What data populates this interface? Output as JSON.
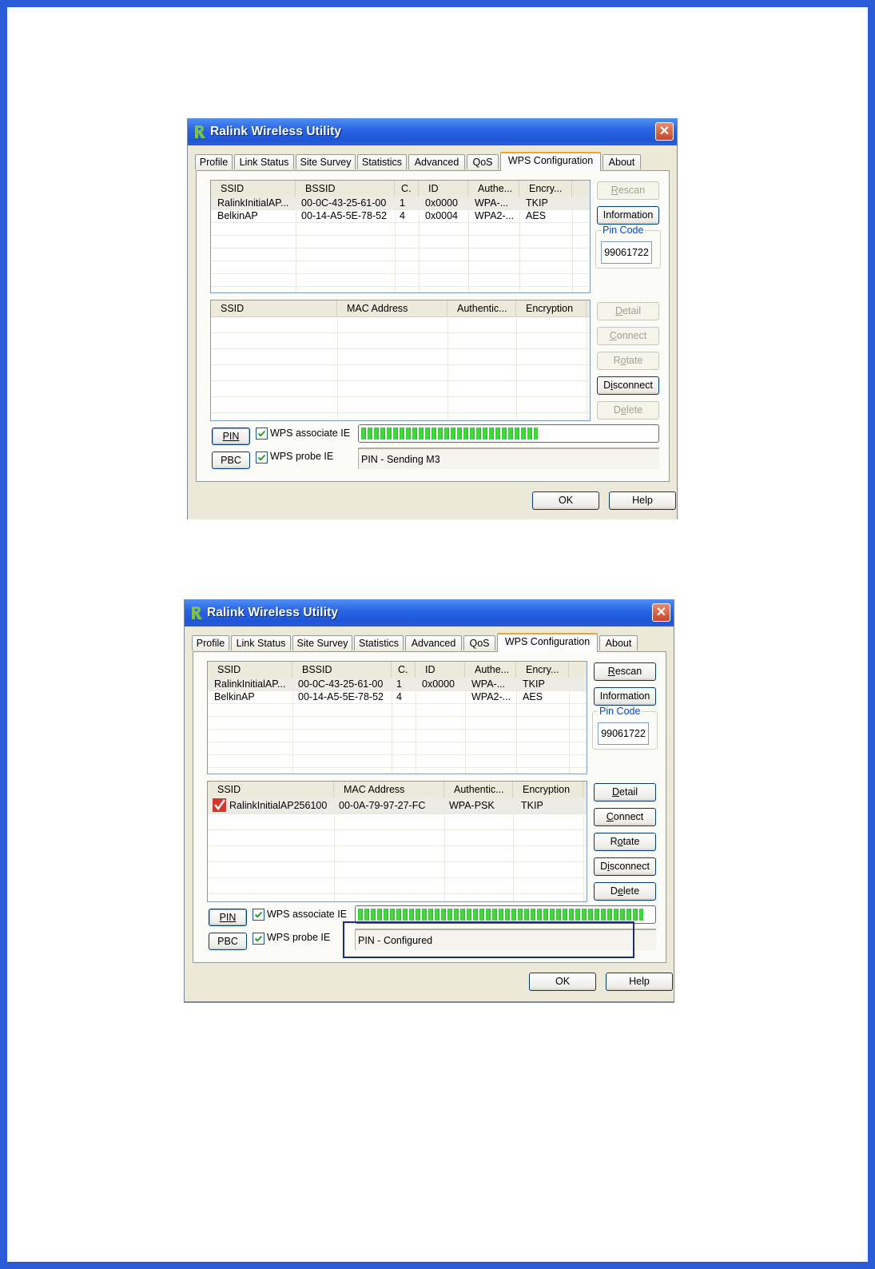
{
  "windows": [
    {
      "title": "Ralink Wireless Utility",
      "close_glyph": "✕",
      "tabs": [
        "Profile",
        "Link Status",
        "Site Survey",
        "Statistics",
        "Advanced",
        "QoS",
        "WPS Configuration",
        "About"
      ],
      "active_tab": "WPS Configuration",
      "ap_list": {
        "headers": [
          "SSID",
          "BSSID",
          "C.",
          "ID",
          "Authe...",
          "Encry..."
        ],
        "rows": [
          [
            "RalinkInitialAP...",
            "00-0C-43-25-61-00",
            "1",
            "0x0000",
            "WPA-...",
            "TKIP"
          ],
          [
            "BelkinAP",
            "00-14-A5-5E-78-52",
            "4",
            "0x0004",
            "WPA2-...",
            "AES"
          ]
        ]
      },
      "buttons_top": {
        "rescan": "Rescan",
        "information": "Information"
      },
      "pin_code": {
        "label": "Pin Code",
        "value": "99061722"
      },
      "credential_list": {
        "headers": [
          "SSID",
          "MAC Address",
          "Authentic...",
          "Encryption"
        ],
        "rows": []
      },
      "buttons_side": {
        "detail": "Detail",
        "connect": "Connect",
        "rotate": "Rotate",
        "disconnect": "Disconnect",
        "delete": "Delete"
      },
      "pin_button": "PIN",
      "pbc_button": "PBC",
      "wps_associate_ie": "WPS associate IE",
      "wps_probe_ie": "WPS probe IE",
      "progress_fraction": 0.62,
      "status": "PIN - Sending M3",
      "ok": "OK",
      "help": "Help"
    },
    {
      "title": "Ralink Wireless Utility",
      "close_glyph": "✕",
      "tabs": [
        "Profile",
        "Link Status",
        "Site Survey",
        "Statistics",
        "Advanced",
        "QoS",
        "WPS Configuration",
        "About"
      ],
      "active_tab": "WPS Configuration",
      "ap_list": {
        "headers": [
          "SSID",
          "BSSID",
          "C.",
          "ID",
          "Authe...",
          "Encry..."
        ],
        "rows": [
          [
            "RalinkInitialAP...",
            "00-0C-43-25-61-00",
            "1",
            "0x0000",
            "WPA-...",
            "TKIP"
          ],
          [
            "BelkinAP",
            "00-14-A5-5E-78-52",
            "4",
            "",
            "WPA2-...",
            "AES"
          ]
        ]
      },
      "buttons_top": {
        "rescan": "Rescan",
        "information": "Information"
      },
      "pin_code": {
        "label": "Pin Code",
        "value": "99061722"
      },
      "credential_list": {
        "headers": [
          "SSID",
          "MAC Address",
          "Authentic...",
          "Encryption"
        ],
        "rows": [
          [
            "RalinkInitialAP256100",
            "00-0A-79-97-27-FC",
            "WPA-PSK",
            "TKIP"
          ]
        ]
      },
      "buttons_side": {
        "detail": "Detail",
        "connect": "Connect",
        "rotate": "Rotate",
        "disconnect": "Disconnect",
        "delete": "Delete"
      },
      "pin_button": "PIN",
      "pbc_button": "PBC",
      "wps_associate_ie": "WPS associate IE",
      "wps_probe_ie": "WPS probe IE",
      "progress_fraction": 1.0,
      "status": "PIN - Configured",
      "ok": "OK",
      "help": "Help"
    }
  ],
  "colors": {
    "page_border": "#2a5bd7",
    "highlight_box": "#1a2a8c",
    "progress_green": "#2fc82f",
    "check_red": "#d8352c"
  }
}
